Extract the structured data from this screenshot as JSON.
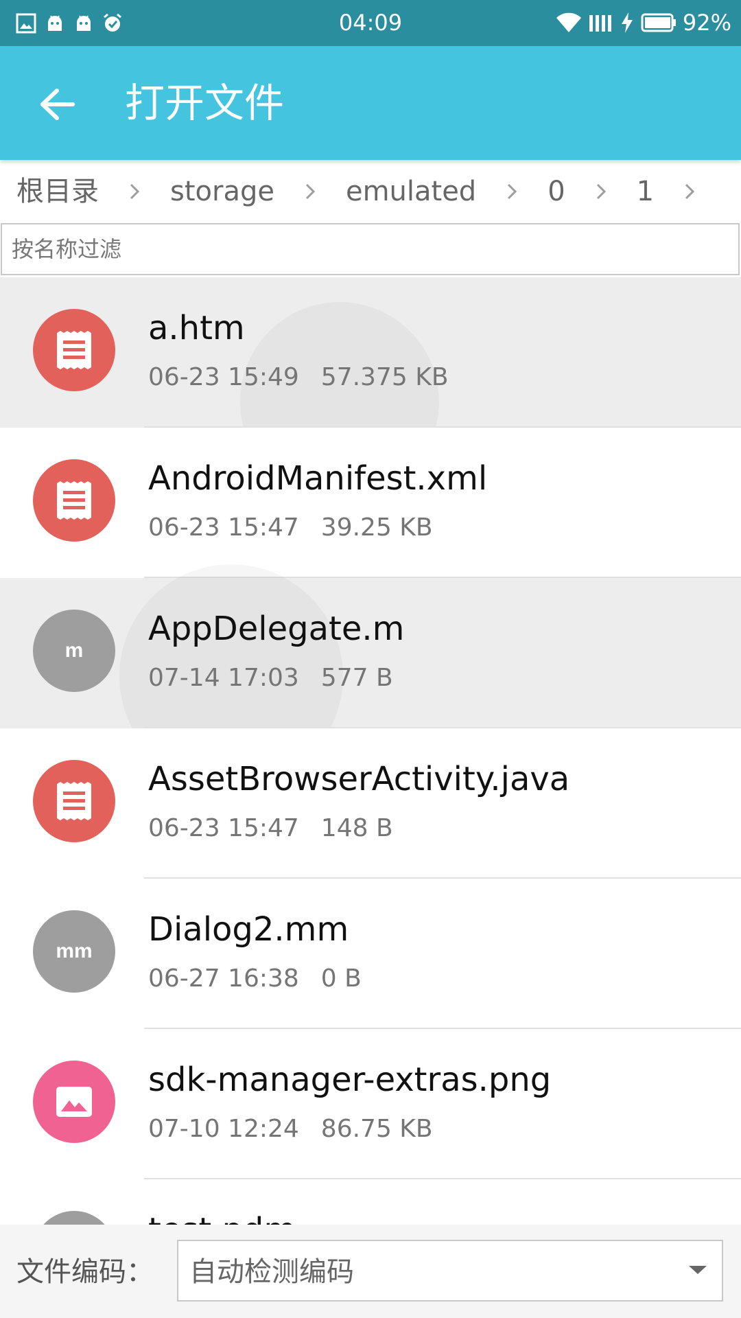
{
  "status_bar": {
    "time": "04:09",
    "battery_percent": "92%",
    "left_icons": [
      "gallery-icon",
      "android-icon",
      "android-icon",
      "alarm-check-icon"
    ],
    "right_icons": [
      "wifi-icon",
      "signal-icon",
      "charging-icon",
      "battery-icon"
    ]
  },
  "app_bar": {
    "title": "打开文件",
    "back_icon": "arrow-left-icon",
    "color": "#44c4df"
  },
  "breadcrumb": {
    "items": [
      "根目录",
      "storage",
      "emulated",
      "0",
      "1"
    ]
  },
  "filter": {
    "placeholder": "按名称过滤",
    "value": ""
  },
  "files": [
    {
      "name": "a.htm",
      "date": "06-23 15:49",
      "size": "57.375 KB",
      "icon": "document-icon",
      "label": "",
      "color": "#e2615a",
      "pressed": true
    },
    {
      "name": "AndroidManifest.xml",
      "date": "06-23 15:47",
      "size": "39.25 KB",
      "icon": "document-icon",
      "label": "",
      "color": "#e2615a",
      "pressed": false
    },
    {
      "name": "AppDelegate.m",
      "date": "07-14 17:03",
      "size": "577 B",
      "icon": "text-badge",
      "label": "m",
      "color": "#9e9e9e",
      "pressed": true
    },
    {
      "name": "AssetBrowserActivity.java",
      "date": "06-23 15:47",
      "size": "148 B",
      "icon": "document-icon",
      "label": "",
      "color": "#e2615a",
      "pressed": false
    },
    {
      "name": "Dialog2.mm",
      "date": "06-27 16:38",
      "size": "0 B",
      "icon": "text-badge",
      "label": "mm",
      "color": "#9e9e9e",
      "pressed": false
    },
    {
      "name": "sdk-manager-extras.png",
      "date": "07-10 12:24",
      "size": "86.75 KB",
      "icon": "image-icon",
      "label": "",
      "color": "#f06292",
      "pressed": false
    },
    {
      "name": "test.pdm",
      "date": "",
      "size": "",
      "icon": "text-badge",
      "label": "",
      "color": "#9e9e9e",
      "pressed": false
    }
  ],
  "bottom_bar": {
    "encoding_label": "文件编码：",
    "encoding_value": "自动检测编码",
    "dropdown_icon": "triangle-down-icon"
  }
}
